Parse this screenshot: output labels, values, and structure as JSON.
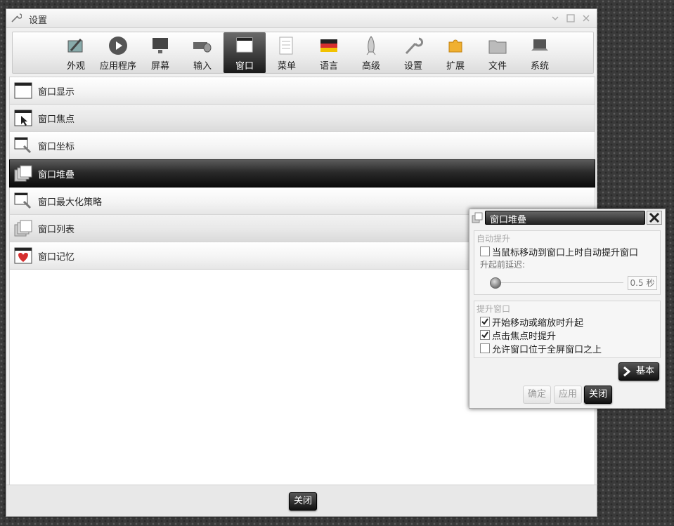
{
  "window": {
    "title": "设置"
  },
  "toolbar": {
    "items": [
      {
        "label": "外观",
        "icon": "appearance-icon"
      },
      {
        "label": "应用程序",
        "icon": "applications-icon"
      },
      {
        "label": "屏幕",
        "icon": "screen-icon"
      },
      {
        "label": "输入",
        "icon": "input-icon"
      },
      {
        "label": "窗口",
        "icon": "window-icon",
        "active": true
      },
      {
        "label": "菜单",
        "icon": "menu-icon"
      },
      {
        "label": "语言",
        "icon": "language-icon"
      },
      {
        "label": "高级",
        "icon": "advanced-icon"
      },
      {
        "label": "设置",
        "icon": "settings-icon"
      },
      {
        "label": "扩展",
        "icon": "extensions-icon"
      },
      {
        "label": "文件",
        "icon": "files-icon"
      },
      {
        "label": "系统",
        "icon": "system-icon"
      }
    ]
  },
  "list": {
    "items": [
      {
        "label": "窗口显示"
      },
      {
        "label": "窗口焦点"
      },
      {
        "label": "窗口坐标"
      },
      {
        "label": "窗口堆叠",
        "selected": true
      },
      {
        "label": "窗口最大化策略"
      },
      {
        "label": "窗口列表"
      },
      {
        "label": "窗口记忆"
      }
    ]
  },
  "footer": {
    "close_label": "关闭"
  },
  "dialog": {
    "title": "窗口堆叠",
    "auto_raise": {
      "group_title": "自动提升",
      "raise_on_hover": {
        "label": "当鼠标移动到窗口上时自动提升窗口",
        "checked": false
      },
      "delay_label": "升起前延迟:",
      "delay_value": "0.5 秒"
    },
    "raise_window": {
      "group_title": "提升窗口",
      "on_move_resize": {
        "label": "开始移动或缩放时升起",
        "checked": true
      },
      "on_focus_click": {
        "label": "点击焦点时提升",
        "checked": true
      },
      "above_fullscreen": {
        "label": "允许窗口位于全屏窗口之上",
        "checked": false
      }
    },
    "basic_label": "基本",
    "ok_label": "确定",
    "apply_label": "应用",
    "close_label": "关闭"
  },
  "colors": {
    "selected": "#111111",
    "accent": "#d62f2f"
  }
}
